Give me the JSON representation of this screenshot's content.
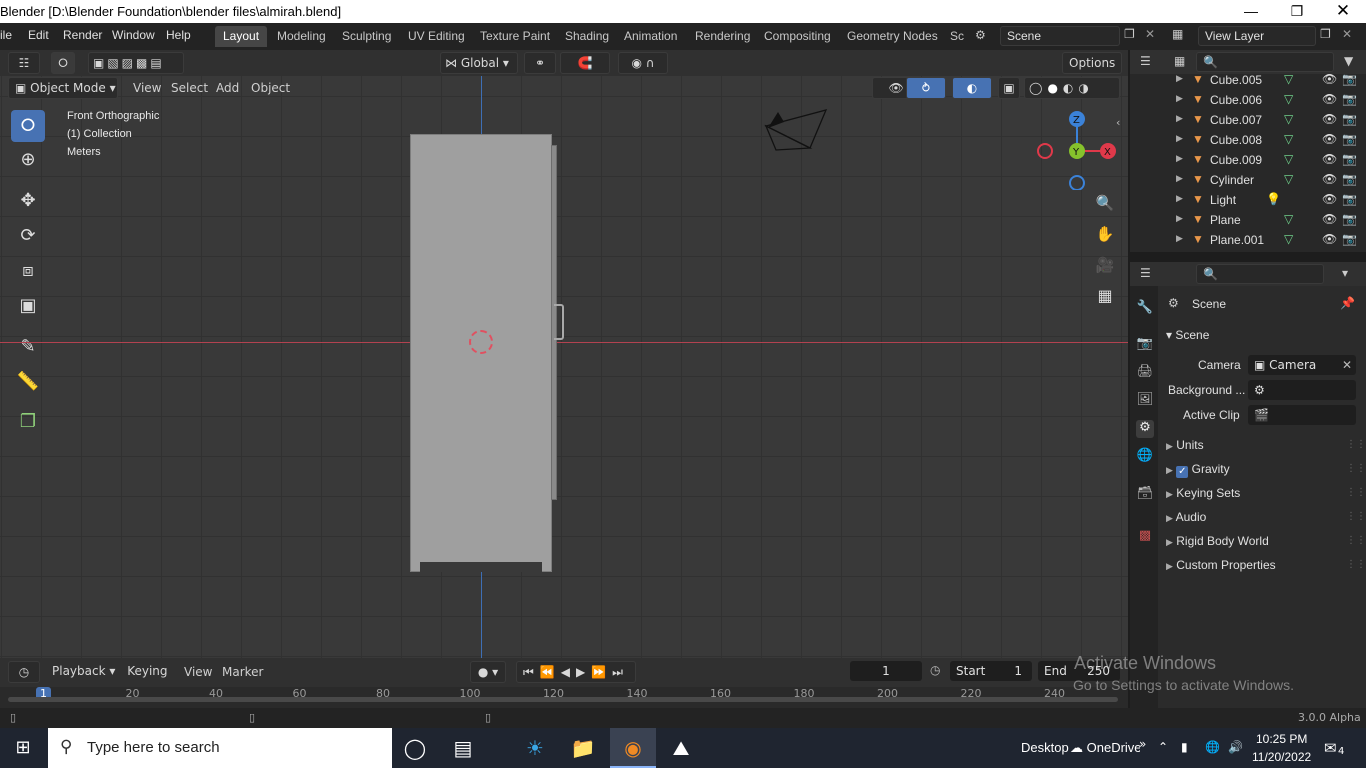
{
  "window": {
    "title": "Blender [D:\\Blender Foundation\\blender files\\almirah.blend]"
  },
  "menus": [
    "ile",
    "Edit",
    "Render",
    "Window",
    "Help"
  ],
  "workspaces": [
    {
      "label": "Layout",
      "active": true
    },
    {
      "label": "Modeling"
    },
    {
      "label": "Sculpting"
    },
    {
      "label": "UV Editing"
    },
    {
      "label": "Texture Paint"
    },
    {
      "label": "Shading"
    },
    {
      "label": "Animation"
    },
    {
      "label": "Rendering"
    },
    {
      "label": "Compositing"
    },
    {
      "label": "Geometry Nodes"
    },
    {
      "label": "Sc"
    }
  ],
  "scene_selector": {
    "value": "Scene"
  },
  "view_layer": {
    "value": "View Layer"
  },
  "header": {
    "transform_orientation": "Global",
    "options": "Options"
  },
  "viewport_header": {
    "mode": "Object Mode",
    "view": "View",
    "select": "Select",
    "add": "Add",
    "object": "Object"
  },
  "overlay_text": {
    "view_name": "Front Orthographic",
    "collection": "(1) Collection",
    "units": "Meters"
  },
  "gizmo": {
    "z": "Z",
    "y": "Y",
    "x": "X"
  },
  "outliner": {
    "items": [
      {
        "name": "Cube.005",
        "type": "mesh"
      },
      {
        "name": "Cube.006",
        "type": "mesh"
      },
      {
        "name": "Cube.007",
        "type": "mesh"
      },
      {
        "name": "Cube.008",
        "type": "mesh"
      },
      {
        "name": "Cube.009",
        "type": "mesh"
      },
      {
        "name": "Cylinder",
        "type": "mesh"
      },
      {
        "name": "Light",
        "type": "light"
      },
      {
        "name": "Plane",
        "type": "mesh"
      },
      {
        "name": "Plane.001",
        "type": "mesh"
      }
    ]
  },
  "properties": {
    "context": "Scene",
    "panel_title": "Scene",
    "camera_label": "Camera",
    "camera_value": "Camera",
    "background_label": "Background ...",
    "active_clip_label": "Active Clip",
    "subpanels": [
      "Units",
      "Gravity",
      "Keying Sets",
      "Audio",
      "Rigid Body World",
      "Custom Properties"
    ],
    "gravity_checked": true
  },
  "timeline": {
    "playback": "Playback",
    "keying": "Keying",
    "view": "View",
    "marker": "Marker",
    "current_frame": "1",
    "start_label": "Start",
    "start_value": "1",
    "end_label": "End",
    "end_value": "250",
    "ruler_ticks": [
      "1",
      "20",
      "40",
      "60",
      "80",
      "100",
      "120",
      "140",
      "160",
      "180",
      "200",
      "220",
      "240"
    ]
  },
  "activation": {
    "line1": "Activate Windows",
    "line2": "Go to Settings to activate Windows."
  },
  "status": {
    "version": "3.0.0 Alpha"
  },
  "taskbar": {
    "search_placeholder": "Type here to search",
    "desktop": "Desktop",
    "onedrive": "OneDrive",
    "time": "10:25 PM",
    "date": "11/20/2022",
    "notifications": "4"
  },
  "colors": {
    "accent": "#4772b3",
    "x_axis": "#e0394a",
    "y_axis": "#86c22c",
    "z_axis": "#3b82d8",
    "viewport_bg": "#393939"
  }
}
